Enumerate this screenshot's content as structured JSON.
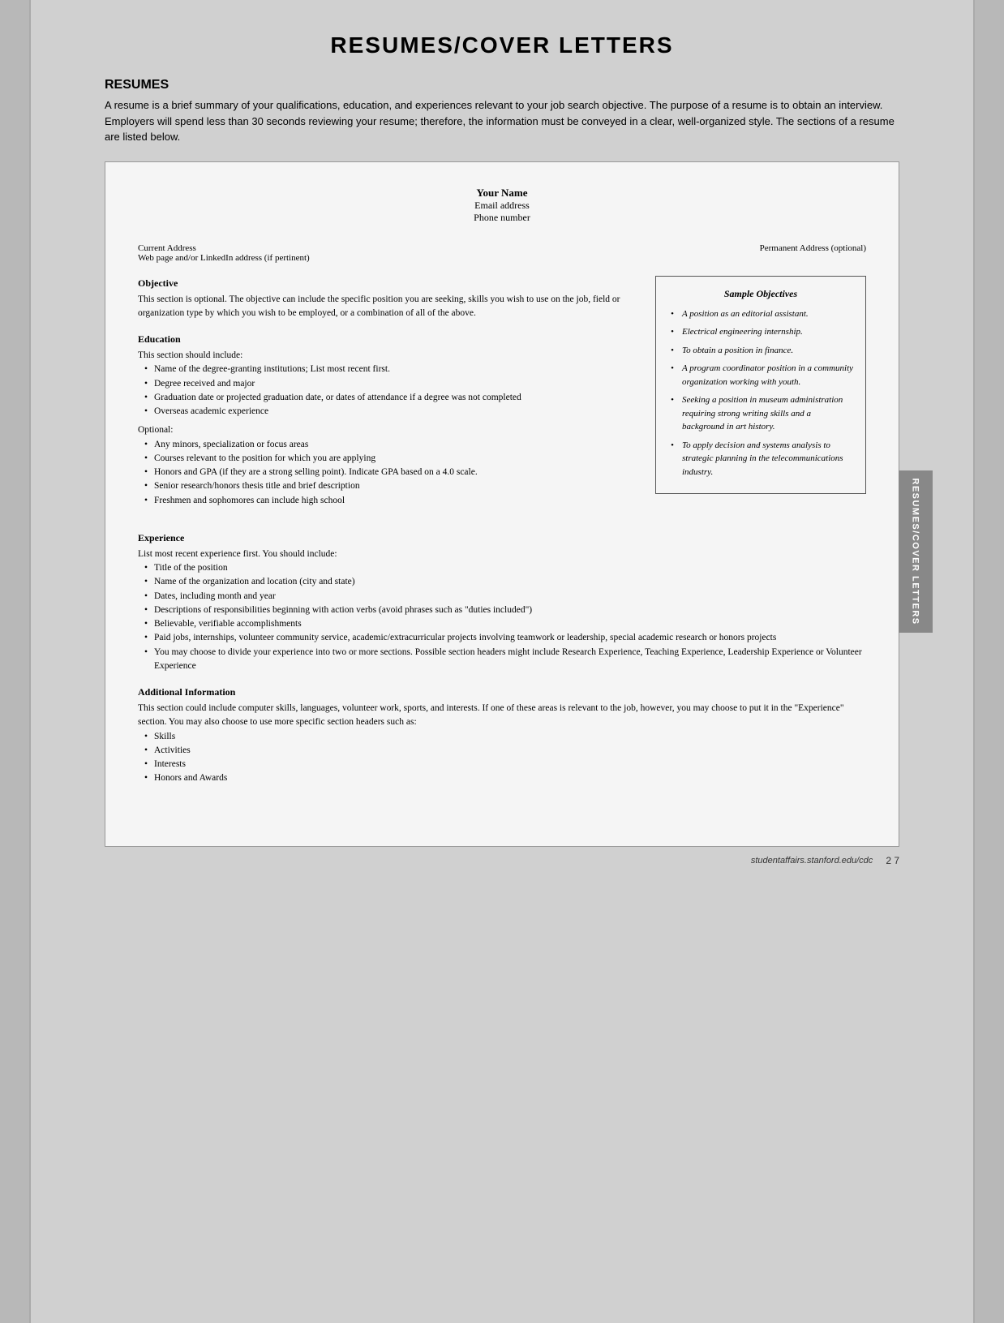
{
  "page": {
    "title": "RESUMES/COVER LETTERS",
    "resumes_header": "RESUMES",
    "intro": "A resume is a brief summary of your qualifications, education, and experiences relevant to your job search objective. The purpose of a resume is to obtain an interview. Employers will spend less than 30 seconds reviewing your resume; therefore, the information must be conveyed in a clear, well-organized style. The sections of a resume are listed below."
  },
  "doc": {
    "your_name": "Your Name",
    "email": "Email address",
    "phone": "Phone number",
    "current_address": "Current Address",
    "web_address": "Web page and/or LinkedIn address (if pertinent)",
    "permanent_address": "Permanent Address (optional)",
    "objective_title": "Objective",
    "objective_text": "This section is optional. The objective can include the specific position you are seeking, skills you wish to use on the job, field or organization type by which you wish to be employed, or a combination of all of the above.",
    "education_title": "Education",
    "education_intro": "This section should include:",
    "education_bullets": [
      "Name of the degree-granting institutions; List most recent first.",
      "Degree received and major",
      "Graduation date or projected graduation date, or dates of attendance if a degree was not completed",
      "Overseas academic experience"
    ],
    "optional_label": "Optional:",
    "optional_bullets": [
      "Any minors, specialization or focus areas",
      "Courses relevant to the position for which you are applying",
      "Honors and GPA (if they are a strong selling point). Indicate GPA based on a 4.0 scale.",
      "Senior research/honors thesis title and brief description",
      "Freshmen and sophomores can include high school"
    ],
    "experience_title": "Experience",
    "experience_intro": "List most recent experience first. You should include:",
    "experience_bullets": [
      "Title of the position",
      "Name of the organization and location (city and state)",
      "Dates, including month and year",
      "Descriptions of responsibilities beginning with action verbs (avoid phrases such as \"duties included\")",
      "Believable, verifiable accomplishments",
      "Paid jobs, internships, volunteer community service, academic/extracurricular projects involving teamwork or leadership, special academic research or honors projects",
      "You may choose to divide your experience into two or more sections. Possible section headers might include Research Experience, Teaching Experience, Leadership Experience or Volunteer Experience"
    ],
    "additional_title": "Additional Information",
    "additional_intro": "This section could include computer skills, languages, volunteer work, sports, and interests. If one of these areas is relevant to the job, however, you may choose to put it in the \"Experience\" section. You may also choose to use more specific section headers such as:",
    "additional_bullets": [
      "Skills",
      "Activities",
      "Interests",
      "Honors and Awards"
    ]
  },
  "sample_objectives": {
    "title": "Sample Objectives",
    "items": [
      "A position as an editorial assistant.",
      "Electrical engineering internship.",
      "To obtain a position in finance.",
      "A program coordinator position in a community organization working with youth.",
      "Seeking a position in museum administration requiring strong writing skills and a background in art history.",
      "To apply decision and systems analysis to strategic planning in the telecommunications industry."
    ]
  },
  "side_tab": {
    "label": "RESUMES/COVER LETTERS"
  },
  "footer": {
    "url": "studentaffairs.stanford.edu/cdc",
    "page": "2  7"
  }
}
